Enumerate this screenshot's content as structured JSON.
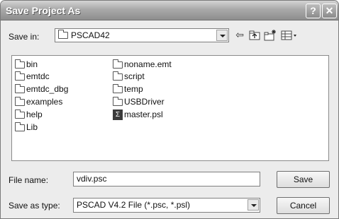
{
  "dialog": {
    "title": "Save Project As",
    "help_glyph": "?",
    "close_glyph": "✕"
  },
  "toolbar": {
    "save_in_label": "Save in:",
    "save_in_value": "PSCAD42",
    "icons": [
      "back-arrow-icon",
      "up-folder-icon",
      "new-folder-icon",
      "view-menu-icon"
    ]
  },
  "files": {
    "column1": [
      {
        "name": "bin",
        "icon": "folder-icon"
      },
      {
        "name": "emtdc",
        "icon": "folder-icon"
      },
      {
        "name": "emtdc_dbg",
        "icon": "folder-icon"
      },
      {
        "name": "examples",
        "icon": "folder-icon"
      },
      {
        "name": "help",
        "icon": "folder-icon"
      },
      {
        "name": "Lib",
        "icon": "folder-icon"
      }
    ],
    "column2": [
      {
        "name": "noname.emt",
        "icon": "folder-icon"
      },
      {
        "name": "script",
        "icon": "folder-icon"
      },
      {
        "name": "temp",
        "icon": "folder-icon"
      },
      {
        "name": "USBDriver",
        "icon": "folder-icon"
      },
      {
        "name": "master.psl",
        "icon": "psl-file-icon"
      }
    ]
  },
  "form": {
    "file_name_label": "File name:",
    "file_name_value": "vdiv.psc",
    "save_type_label": "Save as type:",
    "save_type_value": "PSCAD V4.2 File (*.psc, *.psl)",
    "save_button": "Save",
    "cancel_button": "Cancel"
  }
}
